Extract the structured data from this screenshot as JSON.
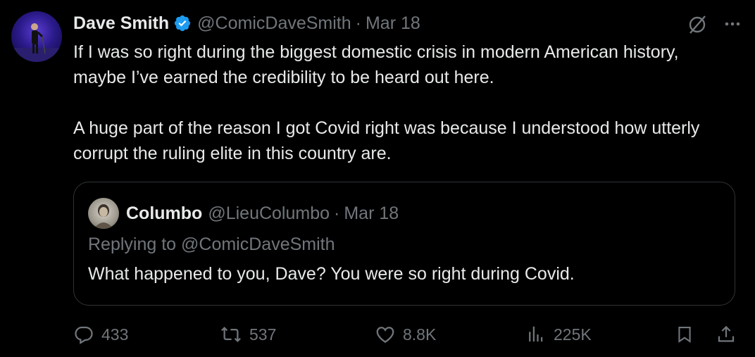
{
  "tweet": {
    "author_name": "Dave Smith",
    "author_handle": "@ComicDaveSmith",
    "separator": "·",
    "date": "Mar 18",
    "paragraphs": [
      "If I was so right during the biggest domestic crisis in modern American history, maybe I’ve earned the credibility to be heard out here.",
      "A huge part of the reason I got Covid right was because I understood how utterly corrupt the ruling elite in this country are."
    ]
  },
  "quote": {
    "author_name": "Columbo",
    "author_handle": "@LieuColumbo",
    "separator": "·",
    "date": "Mar 18",
    "replying_to": "Replying to @ComicDaveSmith",
    "text": "What happened to you, Dave?  You were so right during Covid."
  },
  "actions": {
    "replies": "433",
    "retweets": "537",
    "likes": "8.8K",
    "views": "225K"
  },
  "colors": {
    "background": "#000000",
    "text": "#e7e9ea",
    "muted": "#71767b",
    "verified": "#1d9bf0",
    "border": "#2f3336"
  },
  "icons": [
    "verified-badge-icon",
    "grok-icon",
    "more-icon",
    "reply-icon",
    "retweet-icon",
    "like-icon",
    "views-icon",
    "bookmark-icon",
    "share-icon"
  ]
}
